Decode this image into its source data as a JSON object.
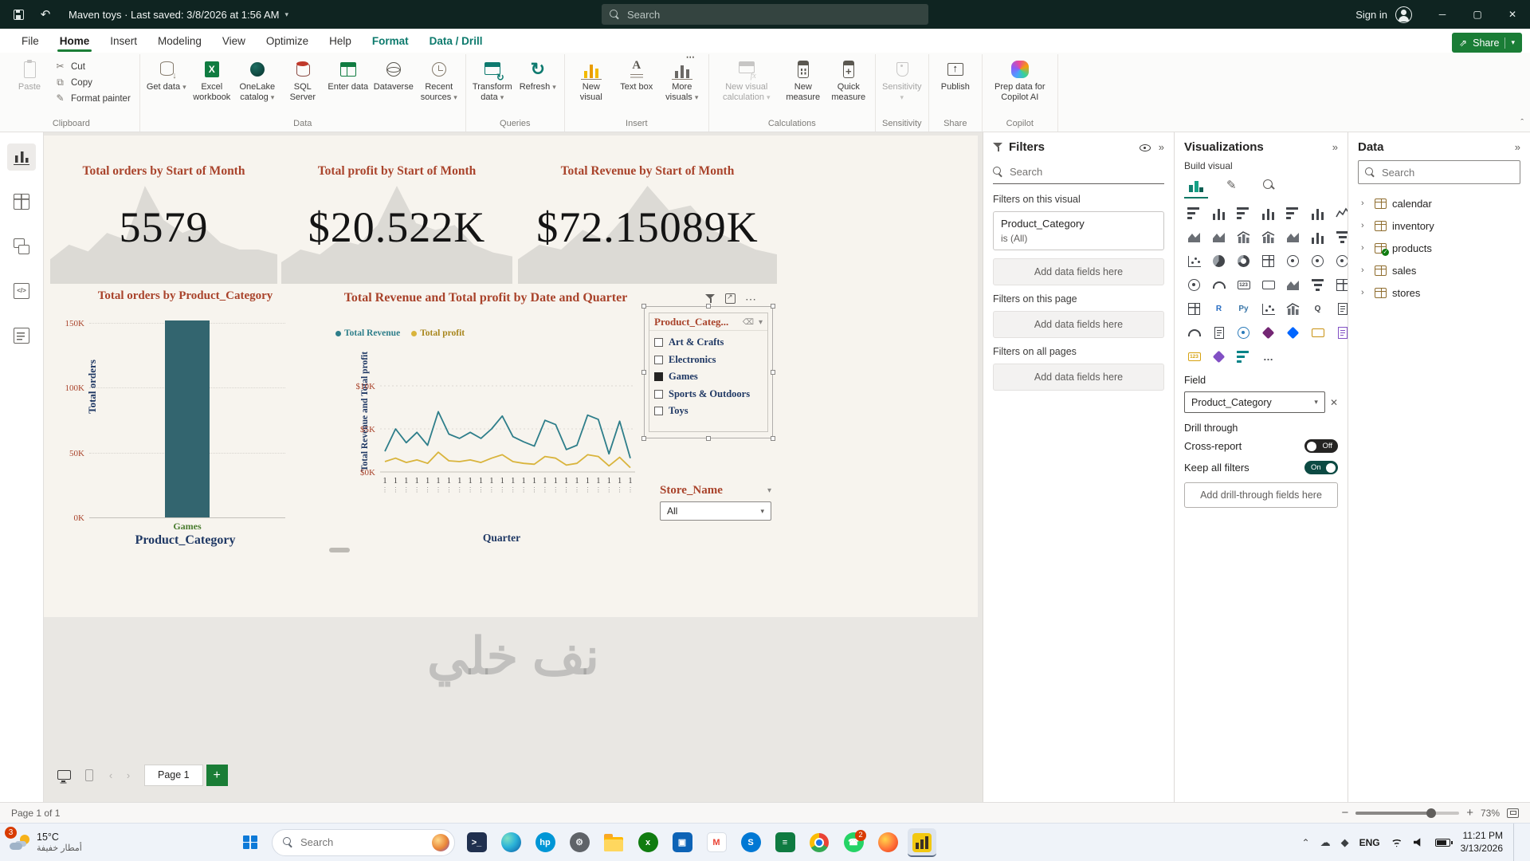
{
  "title_bar": {
    "app_title": "Maven toys · Last saved: 3/8/2026 at 1:56 AM",
    "search_placeholder": "Search",
    "sign_in_label": "Sign in"
  },
  "menu": {
    "share_label": "Share",
    "items": [
      {
        "label": "File",
        "state": "normal"
      },
      {
        "label": "Home",
        "state": "active"
      },
      {
        "label": "Insert",
        "state": "normal"
      },
      {
        "label": "Modeling",
        "state": "normal"
      },
      {
        "label": "View",
        "state": "normal"
      },
      {
        "label": "Optimize",
        "state": "normal"
      },
      {
        "label": "Help",
        "state": "normal"
      },
      {
        "label": "Format",
        "state": "contextual"
      },
      {
        "label": "Data / Drill",
        "state": "contextual"
      }
    ]
  },
  "ribbon": {
    "groups": [
      {
        "label": "Clipboard",
        "large": [
          {
            "label": "Paste",
            "icon": "paste",
            "disabled": true
          }
        ],
        "small": [
          {
            "label": "Cut",
            "icon": "cut"
          },
          {
            "label": "Copy",
            "icon": "copy"
          },
          {
            "label": "Format painter",
            "icon": "painter"
          }
        ]
      },
      {
        "label": "Data",
        "large": [
          {
            "label": "Get data",
            "icon": "getdata",
            "chevron": true
          },
          {
            "label": "Excel workbook",
            "icon": "excel"
          },
          {
            "label": "OneLake catalog",
            "icon": "onelake",
            "chevron": true
          },
          {
            "label": "SQL Server",
            "icon": "sql"
          },
          {
            "label": "Enter data",
            "icon": "enterdata"
          },
          {
            "label": "Dataverse",
            "icon": "dataverse"
          },
          {
            "label": "Recent sources",
            "icon": "recent",
            "chevron": true
          }
        ]
      },
      {
        "label": "Queries",
        "large": [
          {
            "label": "Transform data",
            "icon": "transform",
            "chevron": true
          },
          {
            "label": "Refresh",
            "icon": "refresh",
            "chevron": true
          }
        ]
      },
      {
        "label": "Insert",
        "large": [
          {
            "label": "New visual",
            "icon": "newvisual"
          },
          {
            "label": "Text box",
            "icon": "textbox"
          },
          {
            "label": "More visuals",
            "icon": "morevisuals",
            "chevron": true
          }
        ]
      },
      {
        "label": "Calculations",
        "large": [
          {
            "label": "New visual calculation",
            "icon": "visualcalc",
            "chevron": true,
            "disabled": true,
            "wide": true
          },
          {
            "label": "New measure",
            "icon": "measure"
          },
          {
            "label": "Quick measure",
            "icon": "quickmeasure"
          }
        ]
      },
      {
        "label": "Sensitivity",
        "large": [
          {
            "label": "Sensitivity",
            "icon": "sensitivity",
            "chevron": true,
            "disabled": true
          }
        ]
      },
      {
        "label": "Share",
        "large": [
          {
            "label": "Publish",
            "icon": "publish"
          }
        ]
      },
      {
        "label": "Copilot",
        "large": [
          {
            "label": "Prep data for Copilot AI",
            "icon": "copilot",
            "wide": true
          }
        ]
      }
    ]
  },
  "rail": {
    "items": [
      {
        "name": "report-view",
        "active": true
      },
      {
        "name": "table-view",
        "active": false
      },
      {
        "name": "model-view",
        "active": false
      },
      {
        "name": "dax-query-view",
        "active": false
      },
      {
        "name": "tmdl-view",
        "active": false
      }
    ]
  },
  "chart_data": [
    {
      "type": "card",
      "title": "Total orders by Start of Month",
      "value": "5579",
      "trend": [
        0.25,
        0.4,
        0.33,
        0.52,
        0.45,
        1,
        0.65,
        0.52,
        0.6,
        0.42,
        0.35,
        0.35,
        0.3
      ]
    },
    {
      "type": "card",
      "title": "Total profit by Start of Month",
      "value": "$20.522K",
      "trend": [
        0.22,
        0.35,
        0.3,
        0.45,
        0.4,
        0.6,
        1,
        0.62,
        0.55,
        0.6,
        0.4,
        0.32,
        0.28
      ]
    },
    {
      "type": "card",
      "title": "Total Revenue by Start of Month",
      "value": "$72.15089K",
      "trend": [
        0.25,
        0.4,
        0.35,
        0.55,
        0.45,
        0.7,
        1,
        0.75,
        0.8,
        0.55,
        0.45,
        0.35,
        0.3
      ]
    },
    {
      "type": "bar",
      "title": "Total orders by Product_Category",
      "xlabel": "Product_Category",
      "ylabel": "Total orders",
      "categories": [
        "Games"
      ],
      "values": [
        152000
      ],
      "ylim": [
        0,
        155000
      ],
      "yticks": [
        {
          "label": "0K",
          "value": 0
        },
        {
          "label": "50K",
          "value": 50000
        },
        {
          "label": "100K",
          "value": 100000
        },
        {
          "label": "150K",
          "value": 150000
        }
      ],
      "bar_color": "#33656F",
      "category_label_color": "#4a7c2f"
    },
    {
      "type": "line",
      "title": "Total Revenue and Total profit by Date and Quarter",
      "xlabel": "Quarter",
      "ylabel": "Total Revenue and Total profit",
      "x_tick_label": "1",
      "ylim": [
        0,
        11000
      ],
      "grid": true,
      "legend_position": "top-left",
      "yticks": [
        {
          "label": "$0K",
          "value": 0
        },
        {
          "label": "$5K",
          "value": 5000
        },
        {
          "label": "$10K",
          "value": 10000
        }
      ],
      "series": [
        {
          "name": "Total Revenue",
          "color": "#2E7E8A",
          "values": [
            2400,
            5000,
            3400,
            4600,
            3100,
            7000,
            4400,
            3900,
            4600,
            3900,
            5000,
            6500,
            4100,
            3500,
            3000,
            6000,
            5500,
            2600,
            3100,
            6600,
            6100,
            2100,
            5900,
            1600
          ]
        },
        {
          "name": "Total profit",
          "color": "#D9B43C",
          "values": [
            1200,
            1600,
            1100,
            1400,
            1000,
            2300,
            1300,
            1200,
            1400,
            1100,
            1600,
            2000,
            1200,
            1000,
            900,
            1800,
            1600,
            800,
            1000,
            2000,
            1800,
            700,
            1700,
            500
          ]
        }
      ]
    }
  ],
  "canvas": {
    "slicer": {
      "header": "Product_Categ...",
      "items": [
        {
          "label": "Art & Crafts",
          "checked": false
        },
        {
          "label": "Electronics",
          "checked": false
        },
        {
          "label": "Games",
          "checked": true
        },
        {
          "label": "Sports & Outdoors",
          "checked": false
        },
        {
          "label": "Toys",
          "checked": false
        }
      ]
    },
    "store_slicer": {
      "title": "Store_Name",
      "value": "All"
    },
    "watermark": "نف خلي",
    "page_tab_label": "Page 1",
    "new_page_label": "+"
  },
  "filters_pane": {
    "title": "Filters",
    "search_placeholder": "Search",
    "sections": [
      {
        "title": "Filters on this visual",
        "placeholder": "Add data fields here",
        "filters": [
          {
            "field": "Product_Category",
            "condition": "is (All)"
          }
        ]
      },
      {
        "title": "Filters on this page",
        "placeholder": "Add data fields here",
        "filters": []
      },
      {
        "title": "Filters on all pages",
        "placeholder": "Add data fields here",
        "filters": []
      }
    ]
  },
  "visualizations_pane": {
    "title": "Visualizations",
    "build_label": "Build visual",
    "field_label": "Field",
    "field_value": "Product_Category",
    "drill_label": "Drill through",
    "cross_report_label": "Cross-report",
    "cross_report_state": "Off",
    "keep_filters_label": "Keep all filters",
    "keep_filters_state": "On",
    "drill_placeholder": "Add drill-through fields here",
    "more_options": "…",
    "icons": [
      {
        "n": "stacked-bar-chart",
        "k": "hbar"
      },
      {
        "n": "stacked-column-chart",
        "k": "vbar"
      },
      {
        "n": "clustered-bar-chart",
        "k": "hbar"
      },
      {
        "n": "clustered-column-chart",
        "k": "vbar"
      },
      {
        "n": "100-percent-stacked-bar-chart",
        "k": "hbar"
      },
      {
        "n": "100-percent-stacked-column-chart",
        "k": "vbar"
      },
      {
        "n": "line-chart",
        "k": "line"
      },
      {
        "n": "area-chart",
        "k": "area"
      },
      {
        "n": "stacked-area-chart",
        "k": "area"
      },
      {
        "n": "line-and-stacked-column-chart",
        "k": "combo"
      },
      {
        "n": "line-and-clustered-column-chart",
        "k": "combo"
      },
      {
        "n": "ribbon-chart",
        "k": "area"
      },
      {
        "n": "waterfall-chart",
        "k": "vbar"
      },
      {
        "n": "funnel-chart",
        "k": "funnel"
      },
      {
        "n": "scatter-chart",
        "k": "scatter"
      },
      {
        "n": "pie-chart",
        "k": "pie"
      },
      {
        "n": "donut-chart",
        "k": "donut"
      },
      {
        "n": "treemap",
        "k": "grid"
      },
      {
        "n": "map",
        "k": "map"
      },
      {
        "n": "filled-map",
        "k": "map"
      },
      {
        "n": "shape-map",
        "k": "map"
      },
      {
        "n": "azure-map",
        "k": "map"
      },
      {
        "n": "gauge",
        "k": "gauge"
      },
      {
        "n": "card",
        "k": "card123"
      },
      {
        "n": "multi-row-card",
        "k": "card"
      },
      {
        "n": "kpi",
        "k": "area"
      },
      {
        "n": "slicer",
        "k": "funnel"
      },
      {
        "n": "table",
        "k": "grid"
      },
      {
        "n": "matrix",
        "k": "grid"
      },
      {
        "n": "r-script-visual",
        "k": "txt",
        "t": "R",
        "c": "#276dc3"
      },
      {
        "n": "python-visual",
        "k": "txt",
        "t": "Py",
        "c": "#3b77a8"
      },
      {
        "n": "key-influencers",
        "k": "scatter"
      },
      {
        "n": "decomposition-tree",
        "k": "combo"
      },
      {
        "n": "q-and-a",
        "k": "txt",
        "t": "Q"
      },
      {
        "n": "smart-narrative",
        "k": "doc"
      },
      {
        "n": "metrics",
        "k": "gauge"
      },
      {
        "n": "paginated-report",
        "k": "doc"
      },
      {
        "n": "arcgis-map",
        "k": "map",
        "c": "#2a7ab9"
      },
      {
        "n": "power-apps",
        "k": "diamond",
        "c": "#742774"
      },
      {
        "n": "power-automate",
        "k": "diamond",
        "c": "#0066ff"
      },
      {
        "n": "button-slicer",
        "k": "card",
        "c": "#c99212"
      },
      {
        "n": "text-slicer",
        "k": "doc",
        "c": "#8250c4"
      },
      {
        "n": "new-card-visual",
        "k": "card123",
        "c": "#d6a210"
      },
      {
        "n": "reference-label",
        "k": "diamond",
        "c": "#8250c4"
      },
      {
        "n": "list-slicer",
        "k": "hbar",
        "c": "#038387"
      }
    ]
  },
  "data_pane": {
    "title": "Data",
    "search_placeholder": "Search",
    "tables": [
      {
        "name": "calendar",
        "badge": false
      },
      {
        "name": "inventory",
        "badge": false
      },
      {
        "name": "products",
        "badge": true
      },
      {
        "name": "sales",
        "badge": false
      },
      {
        "name": "stores",
        "badge": false
      }
    ]
  },
  "status_bar": {
    "page_info": "Page 1 of 1",
    "zoom_percent": "73%"
  },
  "taskbar": {
    "weather": {
      "badge": "3",
      "temp": "15°C",
      "condition": "أمطار خفيفة"
    },
    "search_placeholder": "Search",
    "apps": [
      {
        "name": "terminal",
        "bg": "#20304f",
        "glyph": ">_",
        "fg": "#ffffff"
      },
      {
        "name": "microsoft-edge",
        "bg": "radial-gradient(circle at 30% 30%, #7de0c3, #2bb3d8 45%, #0c59a4)",
        "glyph": "",
        "round": true
      },
      {
        "name": "hp-support",
        "bg": "#0096d6",
        "glyph": "hp",
        "fg": "#ffffff",
        "round": true
      },
      {
        "name": "settings",
        "bg": "#5f6368",
        "glyph": "⚙",
        "fg": "#e8eaed",
        "round": true
      },
      {
        "name": "file-explorer",
        "special": "folder"
      },
      {
        "name": "xbox",
        "bg": "#107c10",
        "glyph": "x",
        "fg": "#ffffff",
        "round": true
      },
      {
        "name": "microsoft-store",
        "bg": "#0d63b6",
        "glyph": "▣",
        "fg": "#ffffff"
      },
      {
        "name": "gmail",
        "bg": "#ffffff",
        "glyph": "M",
        "fg": "#ea4335",
        "border": true
      },
      {
        "name": "skype",
        "bg": "#0078d4",
        "glyph": "S",
        "fg": "#ffffff",
        "round": true
      },
      {
        "name": "sticky-notes",
        "bg": "#0f7b41",
        "glyph": "≡",
        "fg": "#ffffff"
      },
      {
        "name": "google-chrome",
        "special": "chrome"
      },
      {
        "name": "whatsapp",
        "bg": "#25d366",
        "glyph": "☎",
        "fg": "#ffffff",
        "round": true,
        "badge": "2"
      },
      {
        "name": "firefox",
        "bg": "radial-gradient(circle at 35% 35%, #ffd54a, #ff7139 55%, #e3350d)",
        "glyph": "",
        "round": true
      },
      {
        "name": "power-bi-desktop",
        "special": "powerbi",
        "active": true
      }
    ],
    "tray": {
      "language": "ENG",
      "time": "11:21 PM",
      "date": "3/13/2026"
    }
  }
}
